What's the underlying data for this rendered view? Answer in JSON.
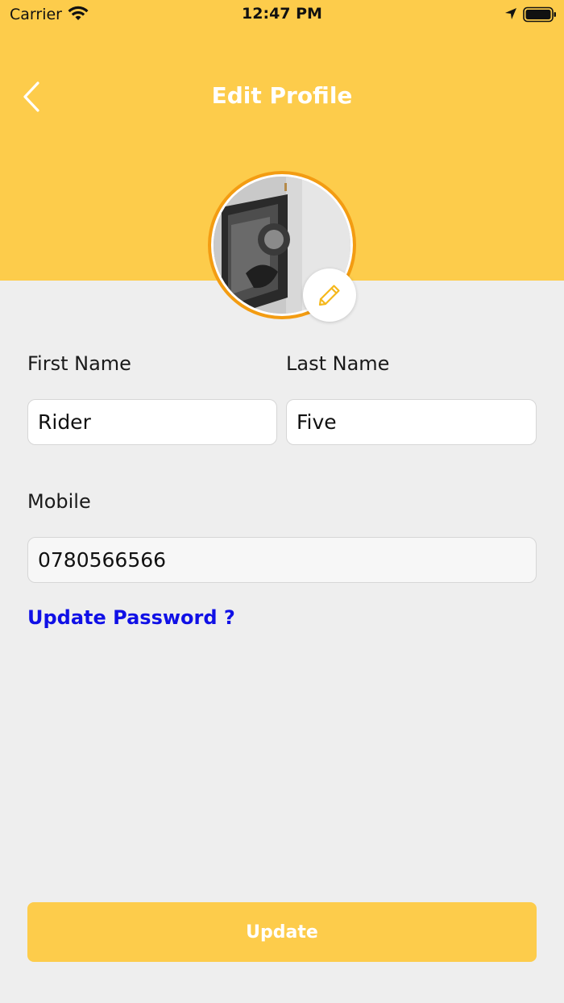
{
  "status_bar": {
    "carrier": "Carrier",
    "time": "12:47 PM",
    "icons": [
      "wifi-icon",
      "location-arrow-icon",
      "battery-icon"
    ]
  },
  "header": {
    "title": "Edit Profile",
    "back_icon": "chevron-left-icon",
    "background_color": "#fdcc4b"
  },
  "avatar": {
    "ring_color": "#f39c12",
    "edit_icon": "pencil-icon"
  },
  "form": {
    "first_name_label": "First Name",
    "first_name_value": "Rider",
    "last_name_label": "Last Name",
    "last_name_value": "Five",
    "mobile_label": "Mobile",
    "mobile_value": "0780566566",
    "update_password_link": "Update Password ?"
  },
  "actions": {
    "update_label": "Update"
  },
  "colors": {
    "accent": "#fdcc4b",
    "link": "#1010e6",
    "background": "#eeeeee"
  }
}
